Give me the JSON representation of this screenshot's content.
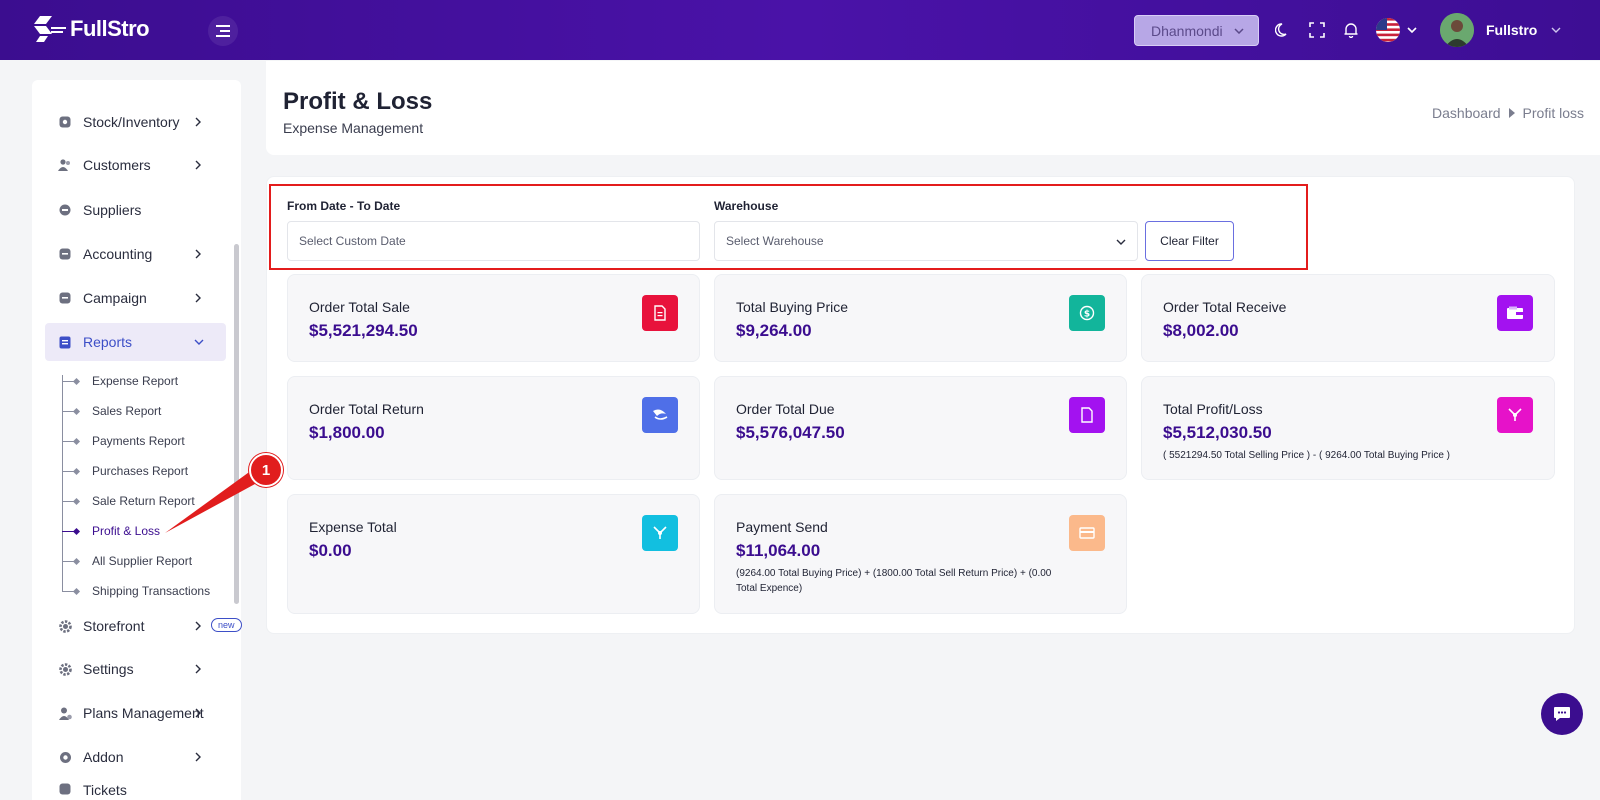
{
  "app": {
    "brand": "FullStro"
  },
  "header": {
    "branch": "Dhanmondi",
    "user_name": "Fullstro",
    "icons": [
      "menu-icon",
      "moon-icon",
      "fullscreen-icon",
      "bell-icon",
      "us-flag-icon",
      "avatar"
    ]
  },
  "sidebar": {
    "items": [
      {
        "label": "Stock/Inventory",
        "icon": "box-icon",
        "chevron": true
      },
      {
        "label": "Customers",
        "icon": "users-icon",
        "chevron": true
      },
      {
        "label": "Suppliers",
        "icon": "supplier-icon",
        "chevron": false
      },
      {
        "label": "Accounting",
        "icon": "ledger-icon",
        "chevron": true
      },
      {
        "label": "Campaign",
        "icon": "campaign-icon",
        "chevron": true
      },
      {
        "label": "Reports",
        "icon": "report-icon",
        "chevron": true,
        "expanded": true
      },
      {
        "label": "Storefront",
        "icon": "gear-icon",
        "chevron": true,
        "badge": "new"
      },
      {
        "label": "Settings",
        "icon": "gear-icon",
        "chevron": true
      },
      {
        "label": "Plans Management",
        "icon": "user-plan-icon",
        "chevron": true
      },
      {
        "label": "Addon",
        "icon": "addon-icon",
        "chevron": true
      },
      {
        "label": "Tickets",
        "icon": "ticket-icon",
        "chevron": false
      }
    ],
    "reports_sub": [
      "Expense Report",
      "Sales Report",
      "Payments Report",
      "Purchases Report",
      "Sale Return Report",
      "Profit & Loss",
      "All Supplier Report",
      "Shipping Transactions"
    ],
    "active_sub": "Profit & Loss"
  },
  "page": {
    "title": "Profit & Loss",
    "subtitle": "Expense Management",
    "breadcrumb": [
      "Dashboard",
      "Profit loss"
    ]
  },
  "filters": {
    "date_label": "From Date - To Date",
    "date_placeholder": "Select Custom Date",
    "warehouse_label": "Warehouse",
    "warehouse_placeholder": "Select Warehouse",
    "clear_label": "Clear Filter"
  },
  "cards": [
    {
      "label": "Order Total Sale",
      "value": "$5,521,294.50",
      "note": "",
      "icon": "invoice-icon",
      "color": "#e8123c"
    },
    {
      "label": "Total Buying Price",
      "value": "$9,264.00",
      "note": "",
      "icon": "dollar-icon",
      "color": "#12b59b"
    },
    {
      "label": "Order Total Receive",
      "value": "$8,002.00",
      "note": "",
      "icon": "wallet-icon",
      "color": "#a312f0"
    },
    {
      "label": "Order Total Return",
      "value": "$1,800.00",
      "note": "",
      "icon": "return-icon",
      "color": "#4f6fe8"
    },
    {
      "label": "Order Total Due",
      "value": "$5,576,047.50",
      "note": "",
      "icon": "document-icon",
      "color": "#a312f0"
    },
    {
      "label": "Total Profit/Loss",
      "value": "$5,512,030.50",
      "note": "( 5521294.50 Total Selling Price ) - ( 9264.00 Total Buying Price )",
      "icon": "chart-icon",
      "color": "#e612c9"
    },
    {
      "label": "Expense Total",
      "value": "$0.00",
      "note": "",
      "icon": "expense-icon",
      "color": "#12bfe0"
    },
    {
      "label": "Payment Send",
      "value": "$11,064.00",
      "note": "(9264.00 Total Buying Price) + (1800.00 Total Sell Return Price) + (0.00 Total Expence)",
      "icon": "card-icon",
      "color": "#fbb98b"
    }
  ],
  "annotation": {
    "number": "1"
  }
}
